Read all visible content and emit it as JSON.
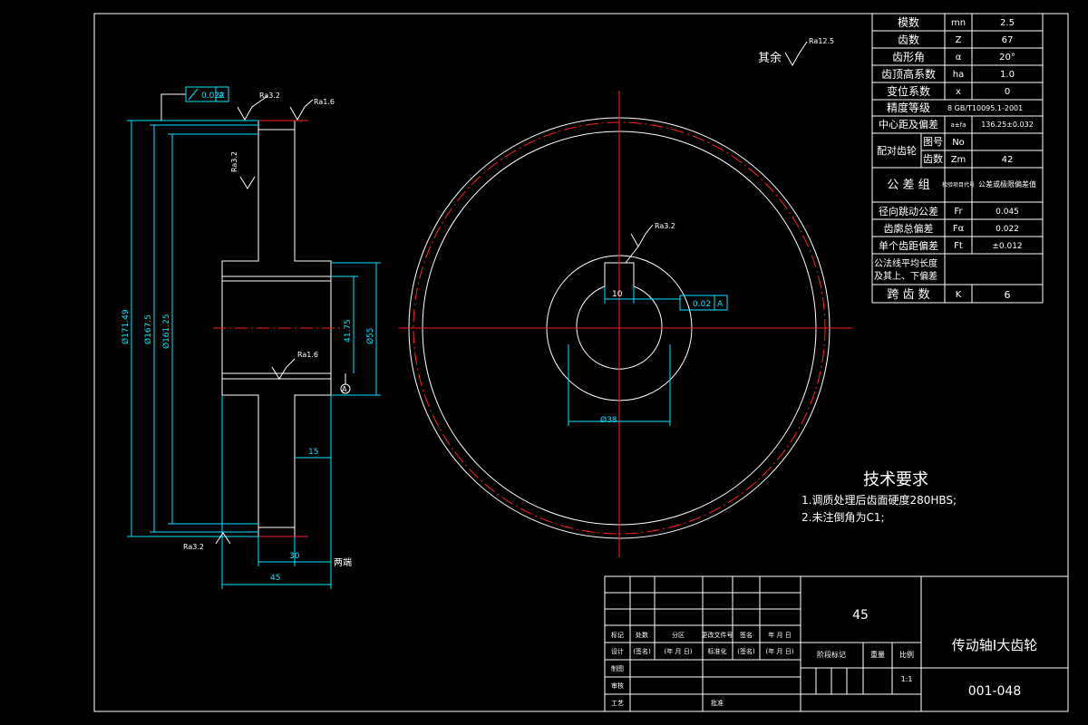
{
  "title_block": {
    "material": "45",
    "part_name": "传动轴Ⅰ大齿轮",
    "drawing_no": "001-048",
    "scale": "1:1",
    "row1": [
      "标记",
      "处数",
      "分区",
      "更改文件号",
      "签名",
      "年 月 日"
    ],
    "row2": [
      "设计",
      "(签名)",
      "(年 月 日)",
      "标准化",
      "(签名)",
      "(年 月 日)"
    ],
    "stage_label": "阶段标记",
    "weight_label": "重量",
    "scale_label": "比例",
    "labels_left": [
      "制图",
      "审核",
      "工艺"
    ],
    "approve_label": "批准"
  },
  "param_table": {
    "rows": [
      {
        "name": "模数",
        "sym": "mn",
        "val": "2.5"
      },
      {
        "name": "齿数",
        "sym": "Z",
        "val": "67"
      },
      {
        "name": "齿形角",
        "sym": "α",
        "val": "20°"
      },
      {
        "name": "齿顶高系数",
        "sym": "ha",
        "val": "1.0"
      },
      {
        "name": "变位系数",
        "sym": "x",
        "val": "0"
      }
    ],
    "precision_label": "精度等级",
    "precision_val": "8  GB/T10095.1-2001",
    "center_label": "中心距及偏差",
    "center_sym": "a±fa",
    "center_val": "136.25±0.032",
    "mate_label": "配对齿轮",
    "mate_drawing_label": "图号",
    "mate_drawing_sym": "No",
    "mate_teeth_label": "齿数",
    "mate_teeth_sym": "Zm",
    "mate_teeth_val": "42",
    "tol_group_label": "公 差 组",
    "tol_item_label": "检验项目代号",
    "tol_value_label": "公差或极限偏差值",
    "tol_rows": [
      {
        "name": "径向跳动公差",
        "sym": "Fr",
        "val": "0.045"
      },
      {
        "name": "齿廓总偏差",
        "sym": "Fα",
        "val": "0.022"
      },
      {
        "name": "单个齿距偏差",
        "sym": "Ft",
        "val": "±0.012"
      }
    ],
    "common_normal_label_1": "公法线平均长度",
    "common_normal_label_2": "及其上、下偏差",
    "span_label": "跨 齿 数",
    "span_sym": "K",
    "span_val": "6"
  },
  "tech_req": {
    "title": "技术要求",
    "items": [
      "1.调质处理后齿面硬度280HBS;",
      "2.未注倒角为C1;"
    ]
  },
  "annotations": {
    "other_label": "其余",
    "ra_125": "Ra12.5",
    "ra_32": "Ra3.2",
    "ra_16": "Ra1.6",
    "runout_tol": "0.022",
    "datum": "A",
    "sym_tol": "0.02",
    "both_ends": "两端"
  },
  "dims": {
    "d_tip": "Ø171.49",
    "d_pitch": "Ø167.5",
    "d_root": "Ø161.25",
    "hub_dia": "Ø55",
    "key_depth": "41.75",
    "bore": "Ø38",
    "key_width": "10",
    "web": "15",
    "face_width": "30",
    "hub_len": "45"
  },
  "colors": {
    "outline": "#ffffff",
    "dimension": "#00e5ff",
    "centerline": "#ff2020",
    "tolerance": "#3cff3c"
  }
}
